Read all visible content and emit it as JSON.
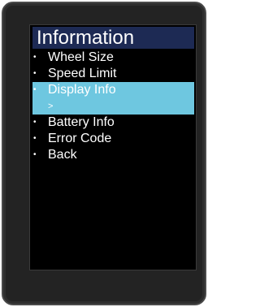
{
  "screen": {
    "title": "Information",
    "menu": [
      {
        "bullet": "•",
        "label": "Wheel Size"
      },
      {
        "bullet": "•",
        "label": "Speed Limit"
      },
      {
        "bullet": "•",
        "label": "Display Info",
        "sub": ">"
      },
      {
        "bullet": "•",
        "label": "Battery Info"
      },
      {
        "bullet": "•",
        "label": "Error Code"
      },
      {
        "bullet": "•",
        "label": "Back"
      }
    ],
    "selected_index": 2
  },
  "colors": {
    "title_bar": "#1d2a54",
    "selection": "#6ec7e0",
    "screen_bg": "#000000",
    "text": "#ffffff",
    "bezel": "#232323"
  }
}
